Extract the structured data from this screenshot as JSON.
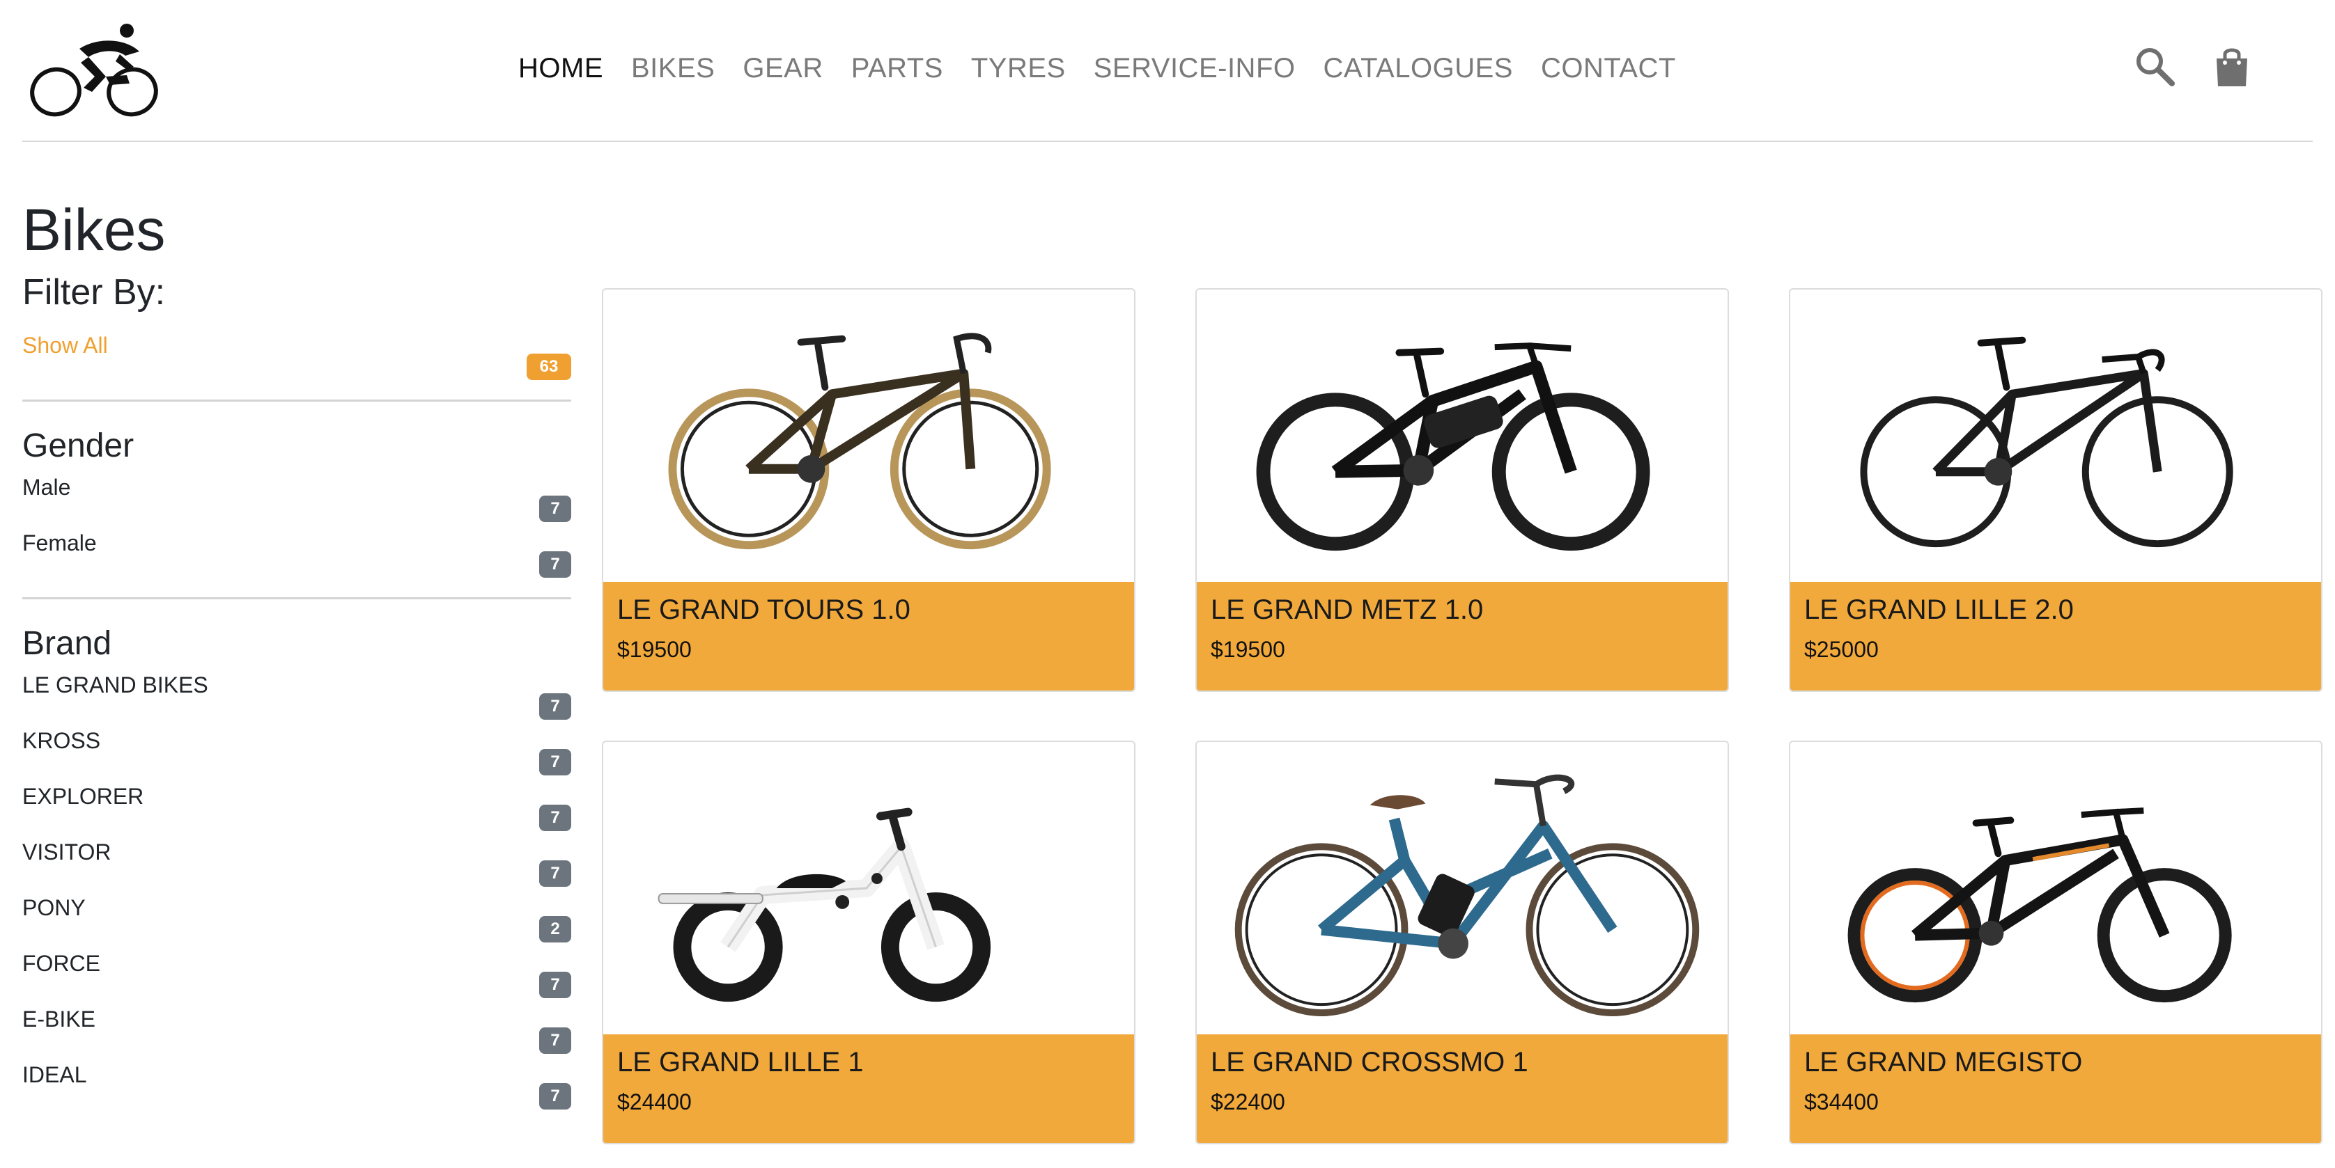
{
  "nav": {
    "items": [
      "HOME",
      "BIKES",
      "GEAR",
      "PARTS",
      "TYRES",
      "SERVICE-INFO",
      "CATALOGUES",
      "CONTACT"
    ]
  },
  "page": {
    "title": "Bikes"
  },
  "filters": {
    "title": "Filter By:",
    "show_all": {
      "label": "Show All",
      "count": "63"
    },
    "gender": {
      "title": "Gender",
      "items": [
        {
          "label": "Male",
          "count": "7"
        },
        {
          "label": "Female",
          "count": "7"
        }
      ]
    },
    "brand": {
      "title": "Brand",
      "items": [
        {
          "label": "LE GRAND BIKES",
          "count": "7"
        },
        {
          "label": "KROSS",
          "count": "7"
        },
        {
          "label": "EXPLORER",
          "count": "7"
        },
        {
          "label": "VISITOR",
          "count": "7"
        },
        {
          "label": "PONY",
          "count": "2"
        },
        {
          "label": "FORCE",
          "count": "7"
        },
        {
          "label": "E-BIKE",
          "count": "7"
        },
        {
          "label": "IDEAL",
          "count": "7"
        }
      ]
    }
  },
  "products": [
    {
      "name": "LE GRAND TOURS 1.0",
      "price": "$19500"
    },
    {
      "name": "LE GRAND METZ 1.0",
      "price": "$19500"
    },
    {
      "name": "LE GRAND LILLE 2.0",
      "price": "$25000"
    },
    {
      "name": "LE GRAND LILLE 1",
      "price": "$24400"
    },
    {
      "name": "LE GRAND CROSSMO 1",
      "price": "$22400"
    },
    {
      "name": "LE GRAND MEGISTO",
      "price": "$34400"
    }
  ],
  "colors": {
    "accent": "#f2a93b",
    "badge": "#6c757d"
  }
}
